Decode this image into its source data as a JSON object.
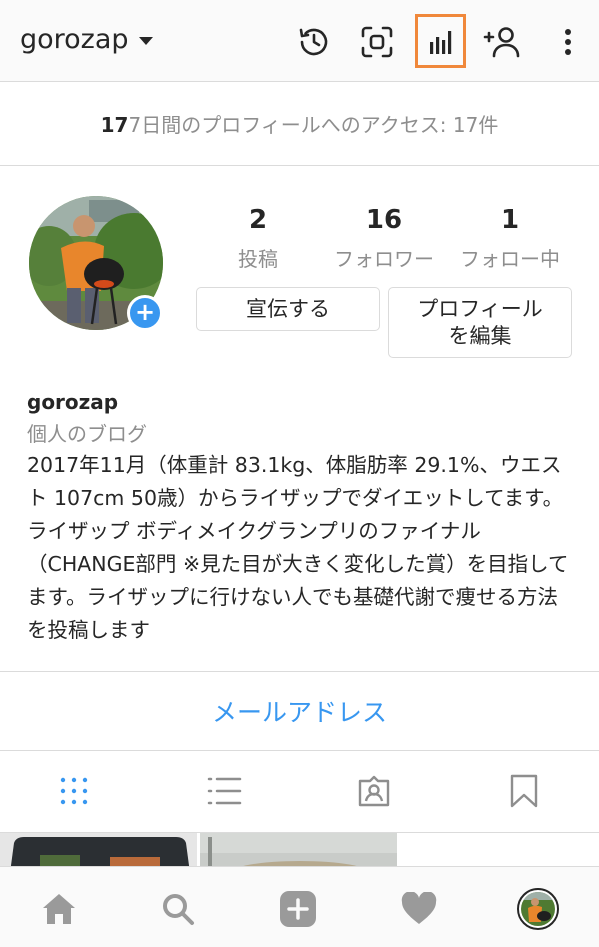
{
  "header": {
    "username": "gorozap"
  },
  "access_banner": {
    "prefix": "17",
    "text": "7日間のプロフィールへのアクセス: 17件"
  },
  "stats": [
    {
      "value": "2",
      "label": "投稿"
    },
    {
      "value": "16",
      "label": "フォロワー"
    },
    {
      "value": "1",
      "label": "フォロー中"
    }
  ],
  "buttons": {
    "promote": "宣伝する",
    "edit_profile_line1": "プロフィール",
    "edit_profile_line2": "を編集"
  },
  "bio": {
    "name": "gorozap",
    "category": "個人のブログ",
    "text": "2017年11月（体重計 83.1kg、体脂肪率 29.1%、ウエスト 107cm 50歳）からライザップでダイエットしてます。ライザップ ボディメイクグランプリのファイナル（CHANGE部門 ※見た目が大きく変化した賞）を目指してます。ライザップに行けない人でも基礎代謝で痩せる方法を投稿します"
  },
  "contact": {
    "email_label": "メールアドレス"
  },
  "icons": {
    "activity": "history-icon",
    "scan": "scan-icon",
    "insights": "bar-chart-icon",
    "discover": "add-person-icon",
    "menu": "more-vert-icon",
    "grid": "grid-icon",
    "list": "list-icon",
    "tagged": "tagged-icon",
    "saved": "bookmark-icon",
    "home": "home-icon",
    "search": "search-icon",
    "add": "add-post-icon",
    "likes": "heart-icon",
    "profile": "profile-avatar"
  },
  "colors": {
    "accent": "#3897f0",
    "highlight": "#f0883b"
  }
}
